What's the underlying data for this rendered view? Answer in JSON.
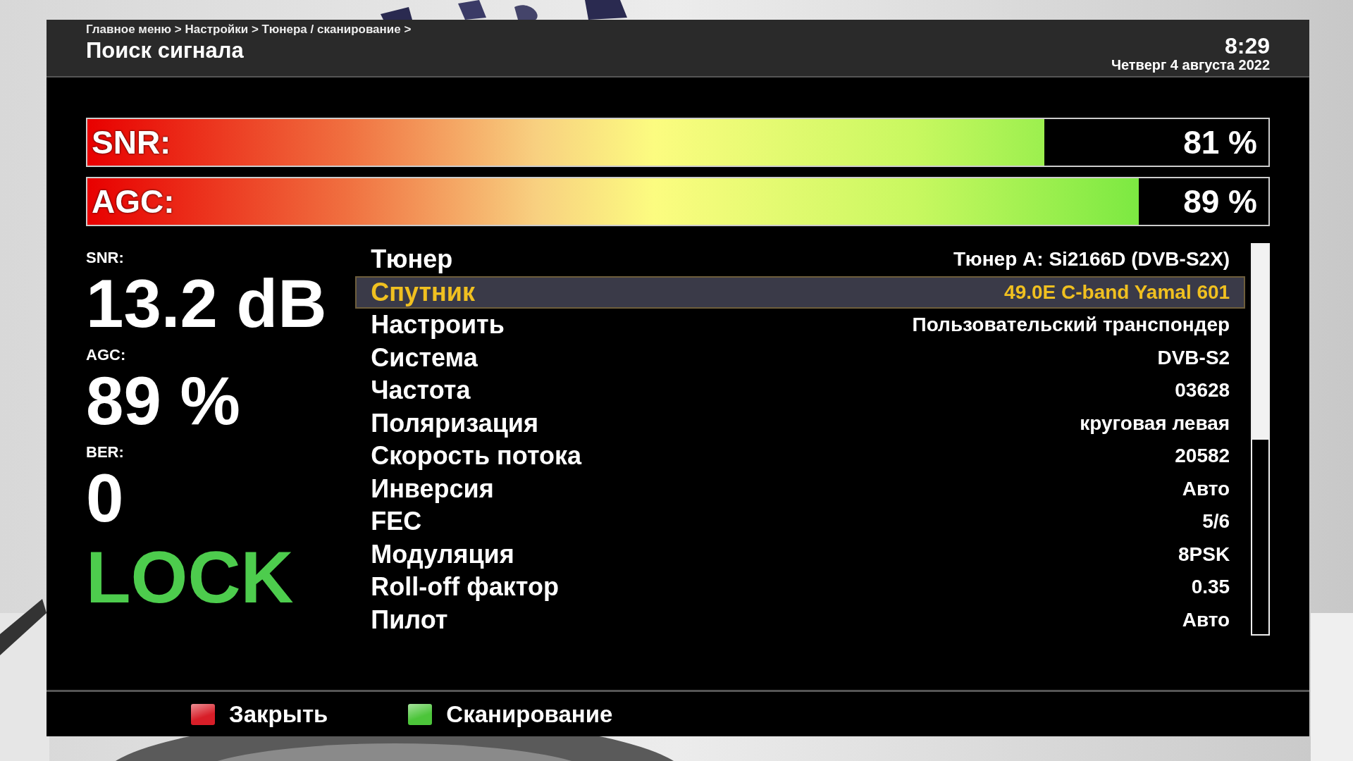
{
  "header": {
    "breadcrumb": "Главное меню > Настройки > Тюнера / сканирование >",
    "title": "Поиск сигнала",
    "time": "8:29",
    "date": "Четверг  4 августа 2022"
  },
  "meters": [
    {
      "label": "SNR:",
      "level": 0.81,
      "reading": "81 %"
    },
    {
      "label": "AGC:",
      "level": 0.89,
      "reading": "89 %"
    }
  ],
  "readings": [
    {
      "label": "SNR:",
      "value": "13.2 dB"
    },
    {
      "label": "AGC:",
      "value": "89 %"
    },
    {
      "label": "BER:",
      "value": "0"
    }
  ],
  "lock_status": {
    "text": "LOCK",
    "locked": true
  },
  "settings": [
    {
      "name": "Тюнер",
      "value": "Тюнер A: Si2166D (DVB-S2X)",
      "selected": false
    },
    {
      "name": "Спутник",
      "value": "49.0E C-band Yamal 601",
      "selected": true
    },
    {
      "name": "Настроить",
      "value": "Пользовательский транспондер",
      "selected": false
    },
    {
      "name": "Система",
      "value": "DVB-S2",
      "selected": false
    },
    {
      "name": "Частота",
      "value": "03628",
      "selected": false
    },
    {
      "name": "Поляризация",
      "value": "круговая левая",
      "selected": false
    },
    {
      "name": "Скорость потока",
      "value": "20582",
      "selected": false
    },
    {
      "name": "Инверсия",
      "value": "Авто",
      "selected": false
    },
    {
      "name": "FEC",
      "value": "5/6",
      "selected": false
    },
    {
      "name": "Модуляция",
      "value": "8PSK",
      "selected": false
    },
    {
      "name": "Roll-off фактор",
      "value": "0.35",
      "selected": false
    },
    {
      "name": "Пилот",
      "value": "Авто",
      "selected": false
    }
  ],
  "footer_buttons": [
    {
      "label": "Закрыть",
      "color": "#d81e28"
    },
    {
      "label": "Сканирование",
      "color": "#4cc53a"
    }
  ]
}
